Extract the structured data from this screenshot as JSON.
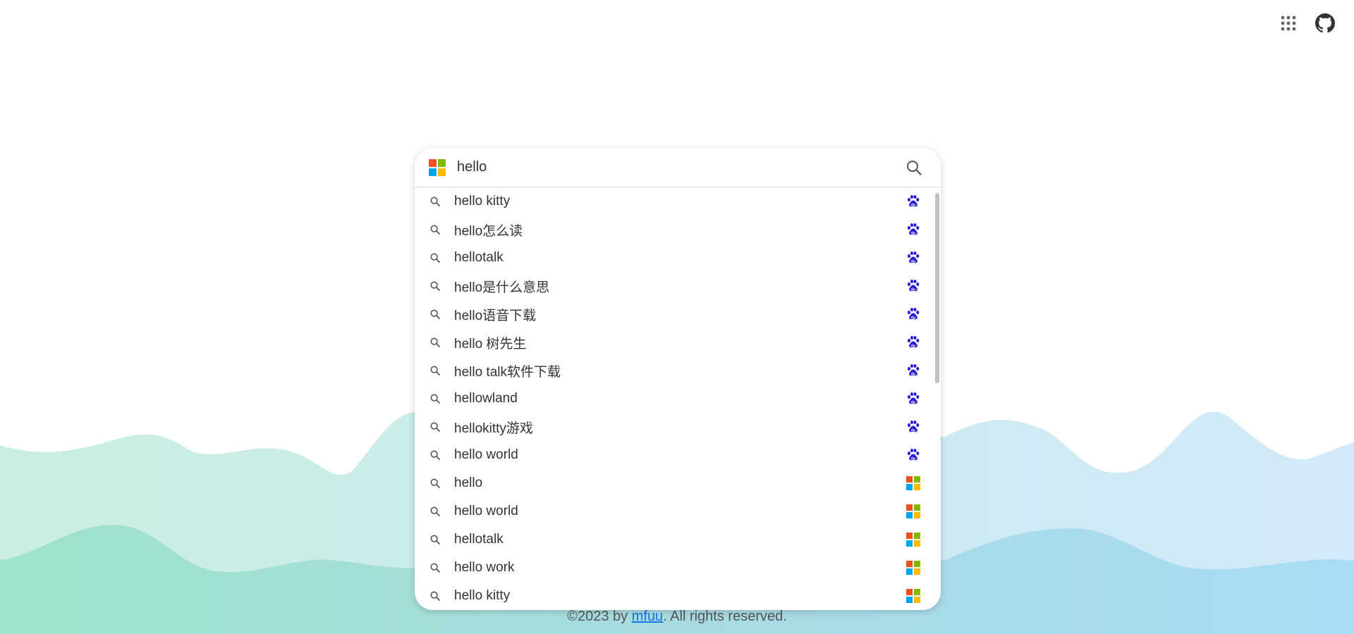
{
  "search": {
    "value": "hello",
    "placeholder": "",
    "engine_logo": "microsoft-bing-logo"
  },
  "suggestions": [
    {
      "text": "hello kitty",
      "source": "baidu"
    },
    {
      "text": "hello怎么读",
      "source": "baidu"
    },
    {
      "text": "hellotalk",
      "source": "baidu"
    },
    {
      "text": "hello是什么意思",
      "source": "baidu"
    },
    {
      "text": "hello语音下载",
      "source": "baidu"
    },
    {
      "text": "hello 树先生",
      "source": "baidu"
    },
    {
      "text": "hello talk软件下载",
      "source": "baidu"
    },
    {
      "text": "hellowland",
      "source": "baidu"
    },
    {
      "text": "hellokitty游戏",
      "source": "baidu"
    },
    {
      "text": "hello world",
      "source": "baidu"
    },
    {
      "text": "hello",
      "source": "microsoft"
    },
    {
      "text": "hello world",
      "source": "microsoft"
    },
    {
      "text": "hellotalk",
      "source": "microsoft"
    },
    {
      "text": "hello work",
      "source": "microsoft"
    },
    {
      "text": "hello kitty",
      "source": "microsoft"
    }
  ],
  "topbar": {
    "apps_icon": "grid-apps-icon",
    "github_icon": "github-icon"
  },
  "footer": {
    "prefix": "©2023 by ",
    "link": "mfuu",
    "suffix": ". All rights reserved."
  },
  "colors": {
    "ms_red": "#f25022",
    "ms_green": "#7fba00",
    "ms_blue": "#00a4ef",
    "ms_yellow": "#ffb900",
    "baidu_blue": "#2319dc",
    "link": "#1a73e8",
    "wave_green": "#a9e6d3",
    "wave_blue": "#b9e0f5"
  }
}
